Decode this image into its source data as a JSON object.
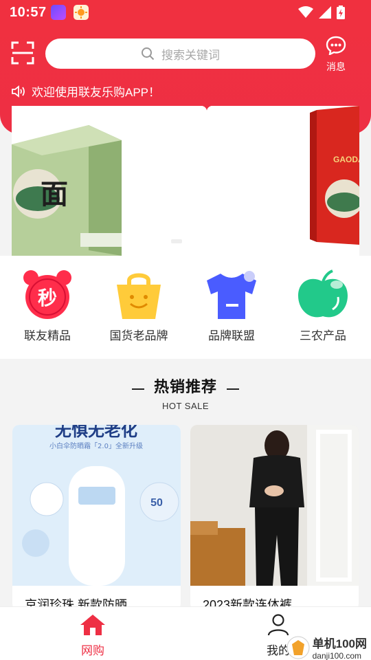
{
  "status": {
    "time": "10:57"
  },
  "header": {
    "search_placeholder": "搜索关键词",
    "message_label": "消息",
    "notice": "欢迎使用联友乐购APP！"
  },
  "banner": {
    "left_product_text": "面",
    "right_product_text": "GAODA"
  },
  "categories": [
    {
      "label": "联友精品",
      "icon": "seckill-clock-icon",
      "badge": "秒"
    },
    {
      "label": "国货老品牌",
      "icon": "shopping-bag-icon"
    },
    {
      "label": "品牌联盟",
      "icon": "tshirt-icon"
    },
    {
      "label": "三农产品",
      "icon": "apple-icon"
    }
  ],
  "hot_sale": {
    "title": "热销推荐",
    "subtitle": "HOT SALE"
  },
  "products": [
    {
      "name": "京润珍珠 新款防晒",
      "img_text": "无惧无老化",
      "img_sub": "小白伞防晒霜「2.0」全新升级"
    },
    {
      "name": "2023新款连体裤"
    }
  ],
  "tabbar": {
    "tabs": [
      {
        "label": "网购",
        "icon": "home-icon"
      },
      {
        "label": "我的",
        "icon": "user-icon"
      }
    ]
  },
  "watermark": {
    "text": "单机100网",
    "url": "danji100.com"
  },
  "colors": {
    "brand_red": "#ee2f44",
    "category_blue": "#4a5cff",
    "category_green": "#22c98a",
    "category_yellow": "#ffcb3a"
  }
}
